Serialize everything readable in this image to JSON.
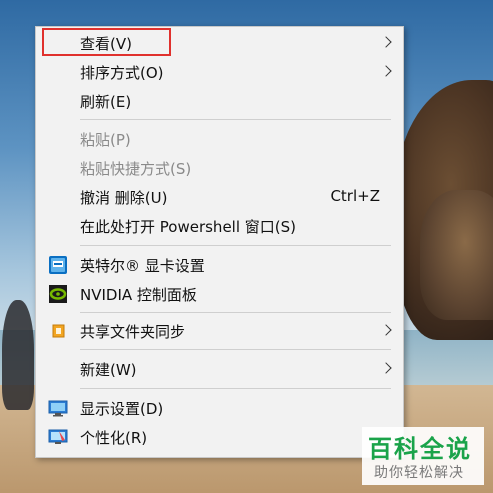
{
  "menu": {
    "items": [
      {
        "label": "查看(V)"
      },
      {
        "label": "排序方式(O)"
      },
      {
        "label": "刷新(E)"
      },
      {
        "label": "粘贴(P)"
      },
      {
        "label": "粘贴快捷方式(S)"
      },
      {
        "label": "撤消 删除(U)",
        "shortcut": "Ctrl+Z"
      },
      {
        "label": "在此处打开 Powershell 窗口(S)"
      },
      {
        "label": "英特尔® 显卡设置",
        "icon": "intel-graphics-icon"
      },
      {
        "label": "NVIDIA 控制面板",
        "icon": "nvidia-icon"
      },
      {
        "label": "共享文件夹同步",
        "icon": "sync-folder-icon"
      },
      {
        "label": "新建(W)"
      },
      {
        "label": "显示设置(D)",
        "icon": "display-icon"
      },
      {
        "label": "个性化(R)",
        "icon": "personalize-icon"
      }
    ]
  },
  "watermark": {
    "title": "百科全说",
    "subtitle": "助你轻松解决"
  },
  "colors": {
    "highlight_border": "#e0312d",
    "menu_background": "#f2f2f2",
    "disabled_text": "#8a8a8a",
    "watermark_green": "#1aa34a"
  }
}
